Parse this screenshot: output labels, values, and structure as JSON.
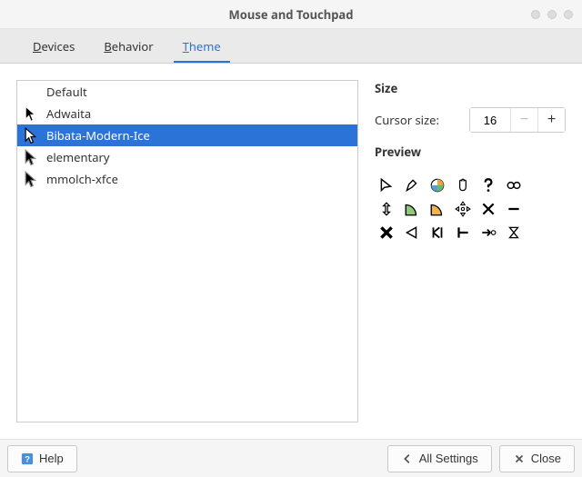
{
  "window": {
    "title": "Mouse and Touchpad"
  },
  "tabs": {
    "devices": "Devices",
    "behavior": "Behavior",
    "theme": "Theme",
    "active": "theme"
  },
  "themes": [
    {
      "name": "Default",
      "has_icon": false,
      "selected": false
    },
    {
      "name": "Adwaita",
      "has_icon": true,
      "selected": false
    },
    {
      "name": "Bibata-Modern-Ice",
      "has_icon": true,
      "selected": true
    },
    {
      "name": "elementary",
      "has_icon": true,
      "selected": false
    },
    {
      "name": "mmolch-xfce",
      "has_icon": true,
      "selected": false
    }
  ],
  "size": {
    "section": "Size",
    "label": "Cursor size:",
    "value": "16"
  },
  "preview": {
    "section": "Preview",
    "icons": [
      "pointer",
      "pen",
      "spinner",
      "hand",
      "question",
      "link",
      "vresize",
      "pie-green",
      "pie-orange",
      "move",
      "xthin",
      "minus",
      "xthick",
      "triangle",
      "split",
      "tee",
      "arrow-right",
      "hourglass"
    ]
  },
  "footer": {
    "help": "Help",
    "all_settings": "All Settings",
    "close": "Close"
  }
}
